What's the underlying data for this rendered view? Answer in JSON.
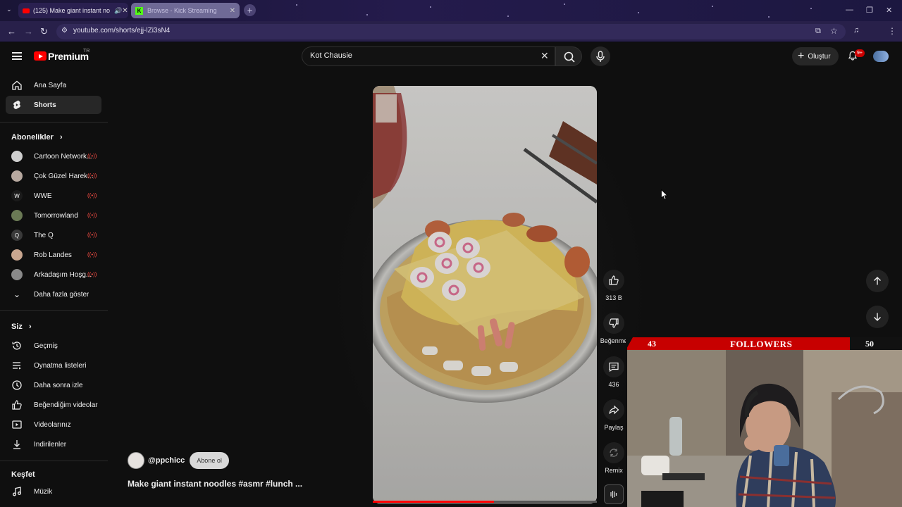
{
  "browser": {
    "tabs": [
      {
        "label": "(125) Make giant instant no",
        "active": true
      },
      {
        "label": "Browse - Kick Streaming",
        "active": false
      }
    ],
    "url": "youtube.com/shorts/ejj-lZi3sN4"
  },
  "header": {
    "logo": "Premium",
    "country": "TR",
    "search_value": "Kot Chausie",
    "create_label": "Oluştur",
    "notif_count": "9+"
  },
  "sidebar": {
    "main": [
      {
        "label": "Ana Sayfa",
        "icon": "home-icon"
      },
      {
        "label": "Shorts",
        "icon": "shorts-icon"
      }
    ],
    "subs_title": "Abonelikler",
    "subs": [
      {
        "label": "Cartoon Network..."
      },
      {
        "label": "Çok Güzel Harek..."
      },
      {
        "label": "WWE"
      },
      {
        "label": "Tomorrowland"
      },
      {
        "label": "The Q"
      },
      {
        "label": "Rob Landes"
      },
      {
        "label": "Arkadaşım Hoşg..."
      }
    ],
    "show_more": "Daha fazla göster",
    "you_title": "Siz",
    "you": [
      {
        "label": "Geçmiş",
        "icon": "history-icon"
      },
      {
        "label": "Oynatma listeleri",
        "icon": "playlist-icon"
      },
      {
        "label": "Daha sonra izle",
        "icon": "clock-icon"
      },
      {
        "label": "Beğendiğim videolar",
        "icon": "like-icon"
      },
      {
        "label": "Videolarınız",
        "icon": "video-icon"
      },
      {
        "label": "İndirilenler",
        "icon": "download-icon"
      }
    ],
    "explore_title": "Keşfet",
    "explore": [
      {
        "label": "Müzik",
        "icon": "music-icon"
      }
    ]
  },
  "short": {
    "channel": "@ppchicc",
    "subscribe": "Abone ol",
    "title": "Make giant instant noodles #asmr #lunch ...",
    "likes": "313 B",
    "dislike_label": "Beğenme",
    "comments": "436",
    "share_label": "Paylaş",
    "remix_label": "Remix",
    "progress": 0.54
  },
  "overlay": {
    "left_count": "43",
    "label": "FOLLOWERS",
    "right_count": "50"
  }
}
